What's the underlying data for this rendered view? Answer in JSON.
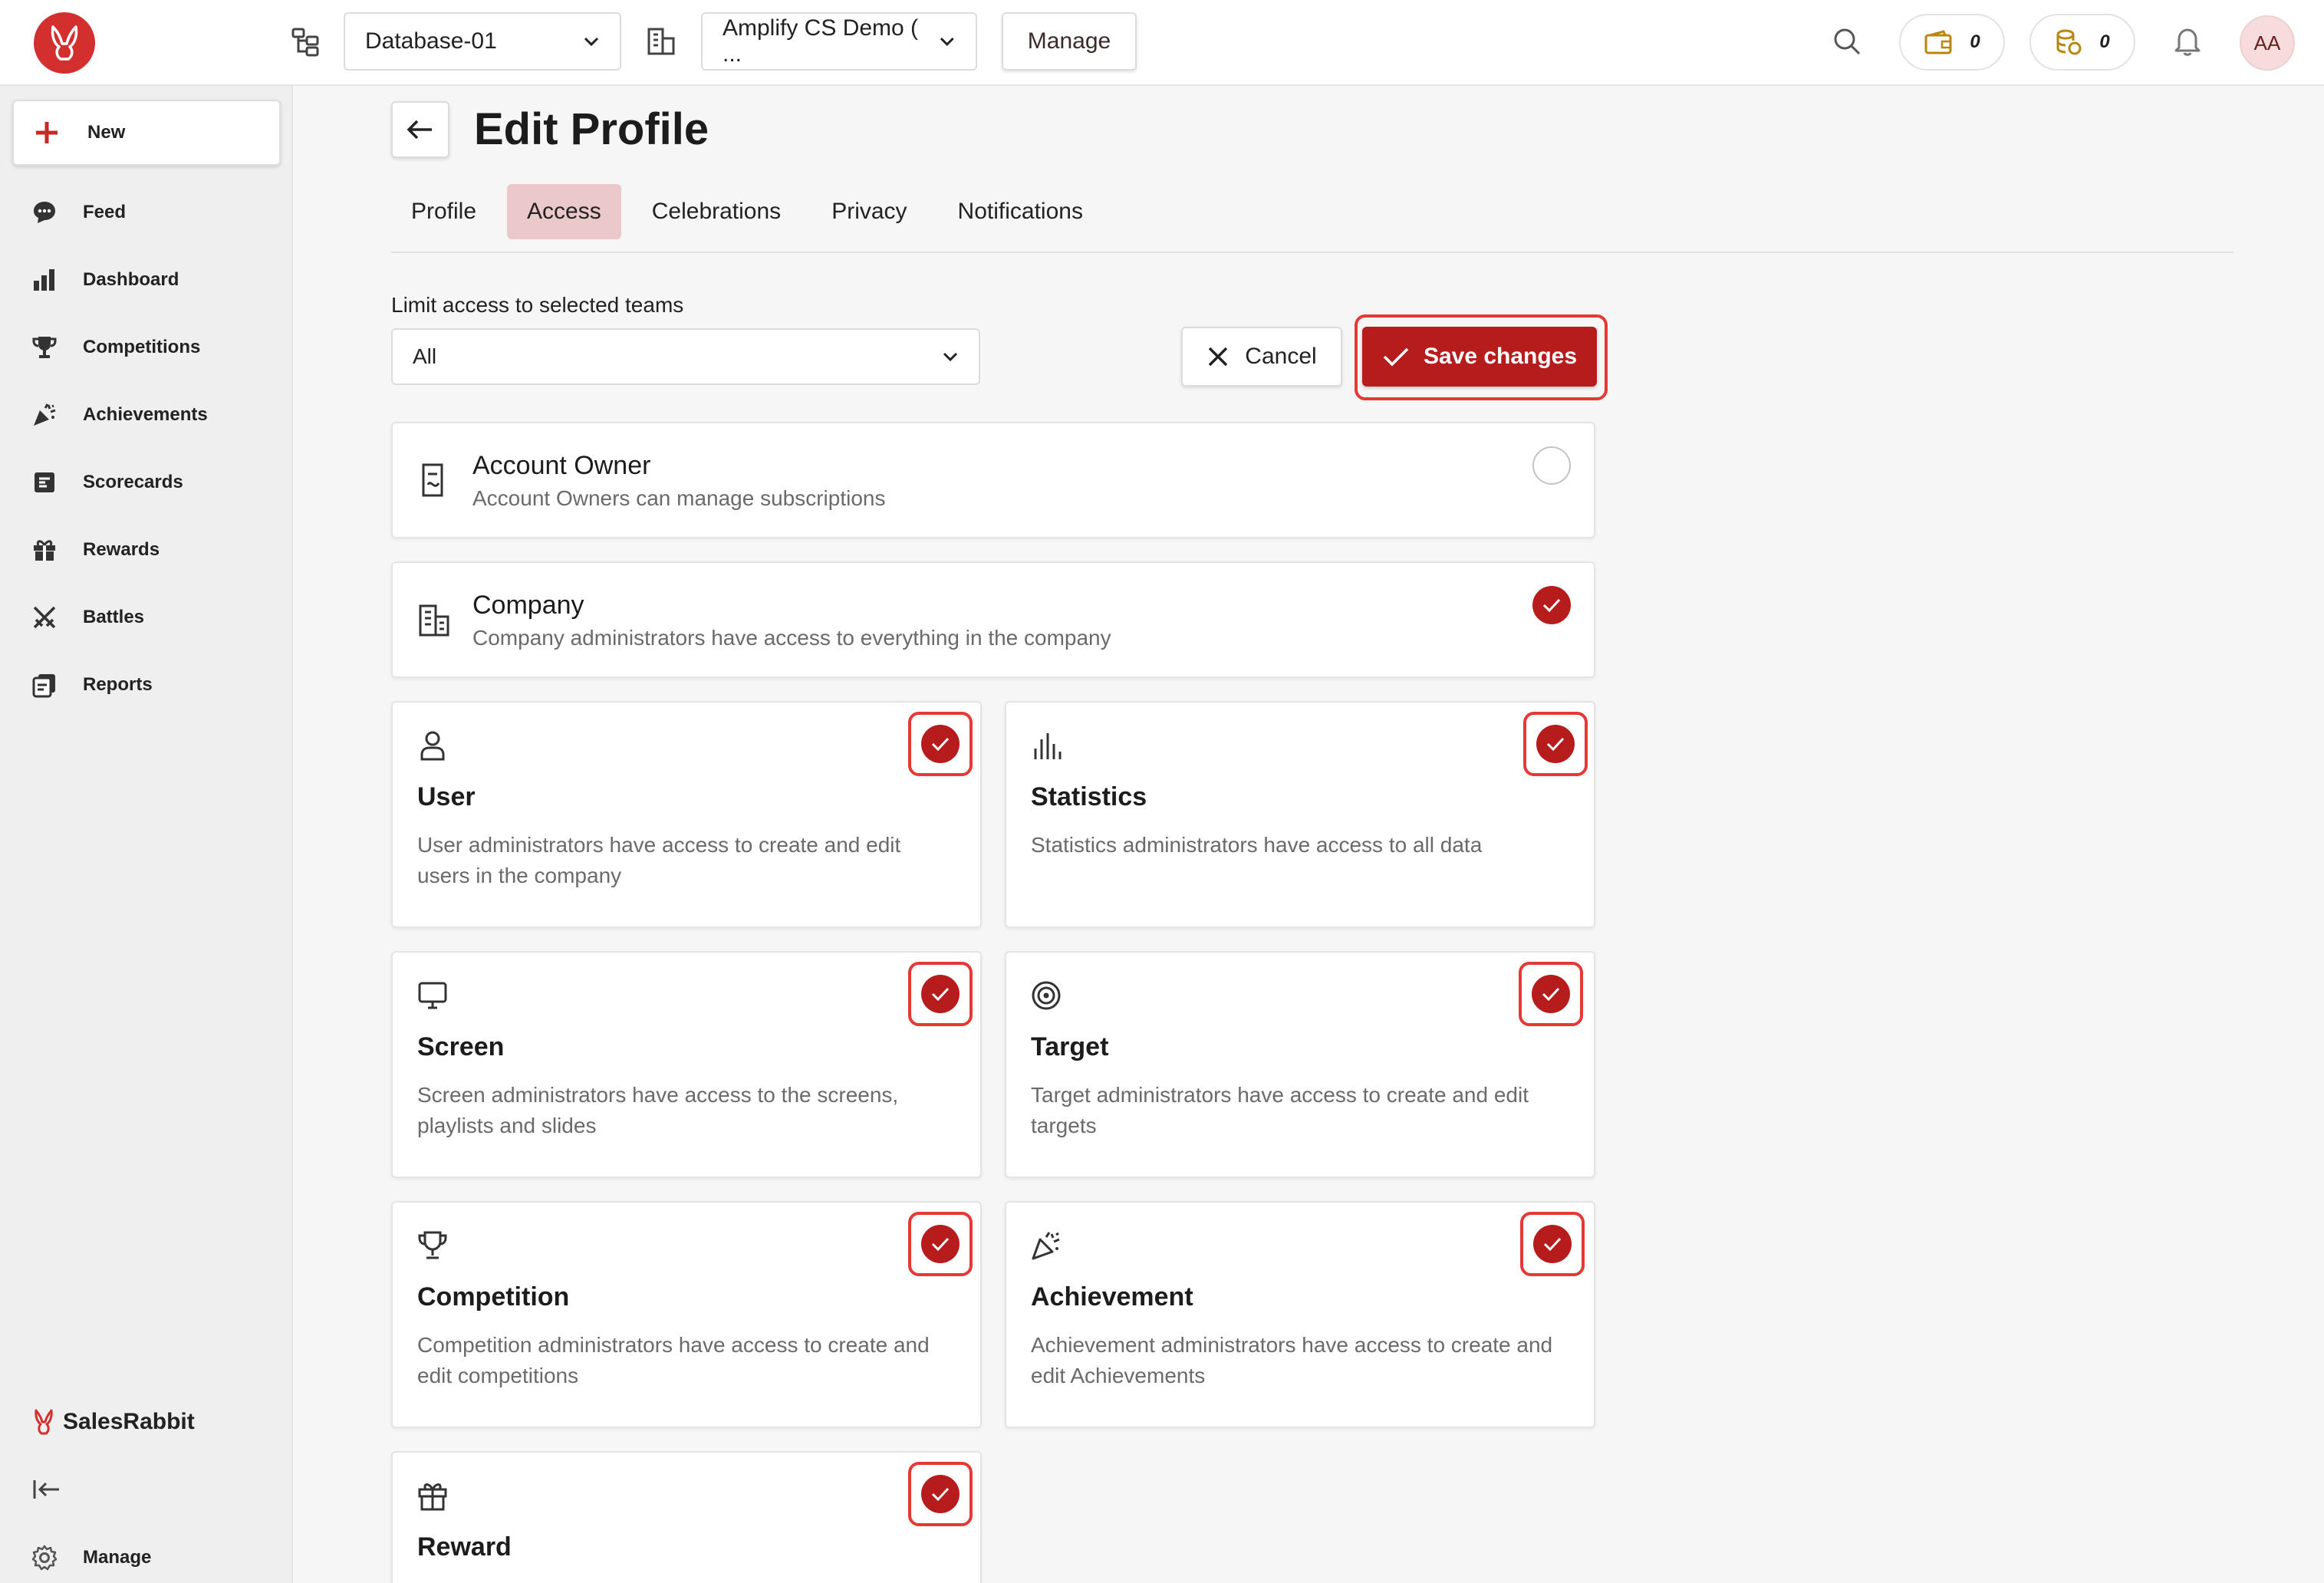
{
  "topbar": {
    "database_select": "Database-01",
    "org_select": "Amplify CS Demo ( ...",
    "manage_label": "Manage",
    "wallet_count": "0",
    "coins_count": "0",
    "avatar_initials": "AA"
  },
  "sidebar": {
    "new_label": "New",
    "items": [
      {
        "label": "Feed",
        "icon": "feed-icon"
      },
      {
        "label": "Dashboard",
        "icon": "dashboard-icon"
      },
      {
        "label": "Competitions",
        "icon": "trophy-icon"
      },
      {
        "label": "Achievements",
        "icon": "party-icon"
      },
      {
        "label": "Scorecards",
        "icon": "scorecard-icon"
      },
      {
        "label": "Rewards",
        "icon": "gift-icon"
      },
      {
        "label": "Battles",
        "icon": "swords-icon"
      },
      {
        "label": "Reports",
        "icon": "reports-icon"
      }
    ],
    "brand": "SalesRabbit",
    "manage_label": "Manage"
  },
  "page": {
    "title": "Edit Profile",
    "tabs": [
      {
        "label": "Profile",
        "active": false
      },
      {
        "label": "Access",
        "active": true
      },
      {
        "label": "Celebrations",
        "active": false
      },
      {
        "label": "Privacy",
        "active": false
      },
      {
        "label": "Notifications",
        "active": false
      }
    ],
    "limit_label": "Limit access to selected teams",
    "limit_value": "All",
    "cancel_label": "Cancel",
    "save_label": "Save changes"
  },
  "roles": {
    "account_owner": {
      "title": "Account Owner",
      "desc": "Account Owners can manage subscriptions",
      "checked": false
    },
    "company": {
      "title": "Company",
      "desc": "Company administrators have access to everything in the company",
      "checked": true
    },
    "user": {
      "title": "User",
      "desc": "User administrators have access to create and edit users in the company",
      "checked": true
    },
    "statistics": {
      "title": "Statistics",
      "desc": "Statistics administrators have access to all data",
      "checked": true
    },
    "screen": {
      "title": "Screen",
      "desc": "Screen administrators have access to the screens, playlists and slides",
      "checked": true
    },
    "target": {
      "title": "Target",
      "desc": "Target administrators have access to create and edit targets",
      "checked": true
    },
    "competition": {
      "title": "Competition",
      "desc": "Competition administrators have access to create and edit competitions",
      "checked": true
    },
    "achievement": {
      "title": "Achievement",
      "desc": "Achievement administrators have access to create and edit Achievements",
      "checked": true
    },
    "reward": {
      "title": "Reward",
      "desc": "",
      "checked": true
    }
  },
  "colors": {
    "accent": "#b71c1c",
    "highlight": "#e53935",
    "active_tab": "#ebc9cb"
  }
}
